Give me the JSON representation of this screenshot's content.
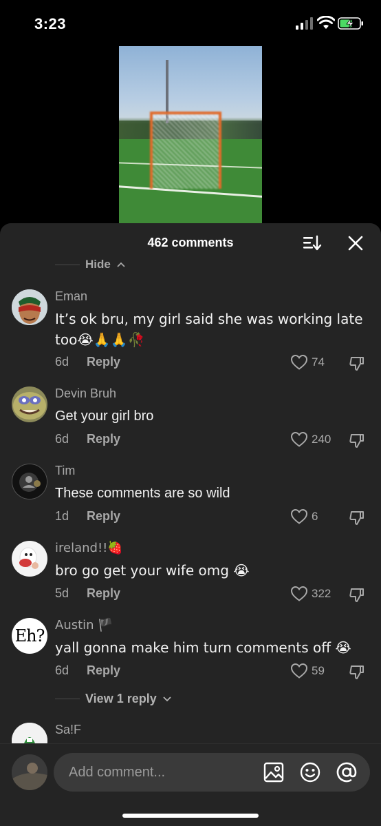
{
  "status_bar": {
    "time": "3:23"
  },
  "sheet": {
    "title": "462 comments",
    "hide_label": "Hide",
    "view_replies": "View 1 reply"
  },
  "comments": [
    {
      "user": "Eman",
      "text": "It’s ok bru, my girl said she was working late too😭🙏🙏🥀",
      "age": "6d",
      "reply": "Reply",
      "likes": "74"
    },
    {
      "user": "Devin Bruh",
      "text": "Get your girl bro",
      "age": "6d",
      "reply": "Reply",
      "likes": "240"
    },
    {
      "user": "Tim",
      "text": "These comments are so wild",
      "age": "1d",
      "reply": "Reply",
      "likes": "6"
    },
    {
      "user": "ireland!!🍓",
      "text": "bro go get your wife omg 😭",
      "age": "5d",
      "reply": "Reply",
      "likes": "322"
    },
    {
      "user": "Austin 🏴",
      "text": "yall gonna make him turn comments off 😭",
      "age": "6d",
      "reply": "Reply",
      "likes": "59"
    },
    {
      "user": "Sa!F"
    }
  ],
  "avatars": {
    "austin": "Eh?"
  },
  "composer": {
    "placeholder": "Add comment..."
  },
  "icons": [
    "signal-icon",
    "wifi-icon",
    "battery-charging-icon",
    "sort-icon",
    "close-icon",
    "heart-icon",
    "dislike-icon",
    "image-icon",
    "emoji-icon",
    "mention-icon"
  ]
}
